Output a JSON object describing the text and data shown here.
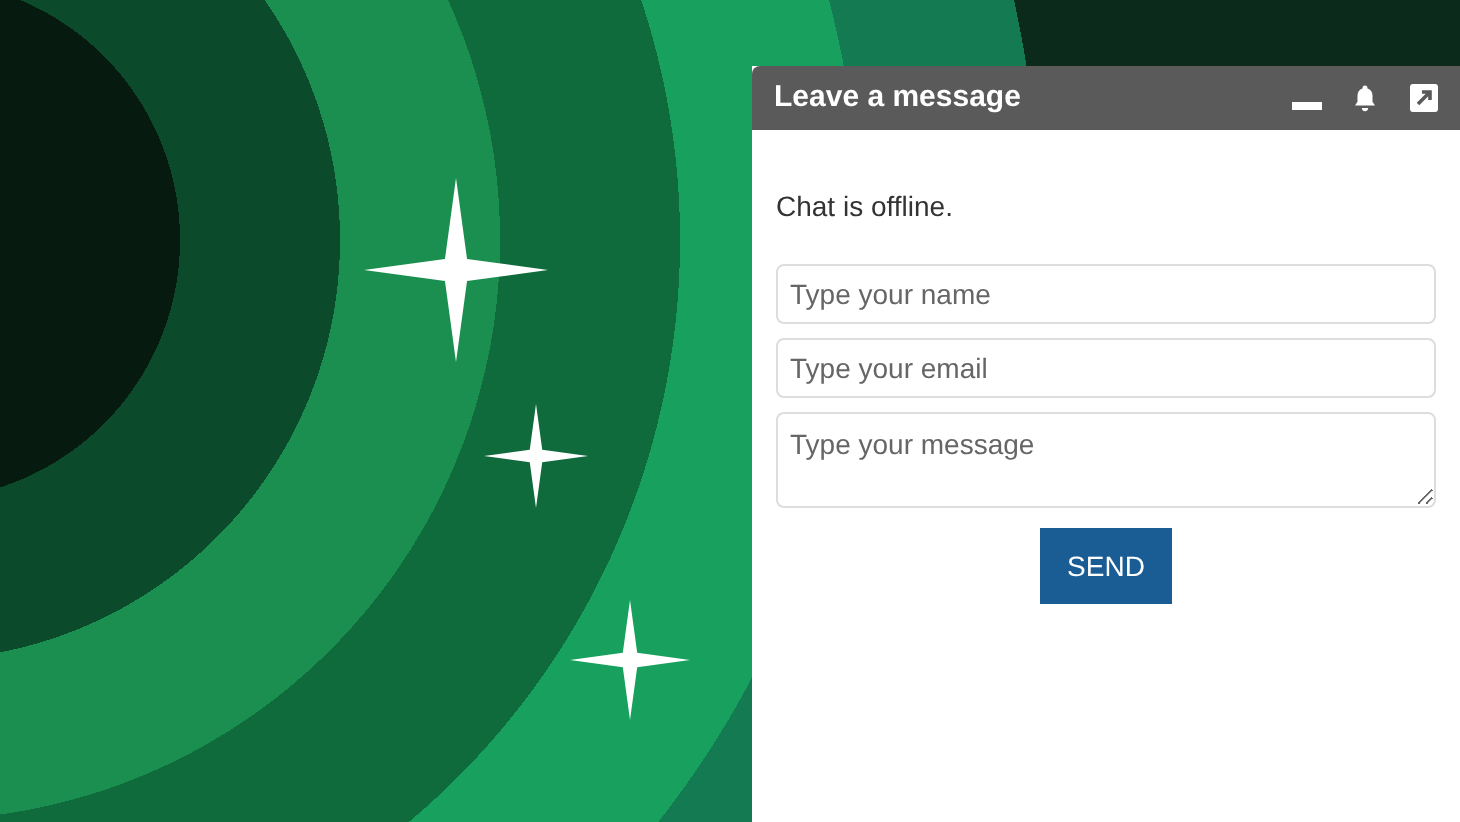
{
  "chat_widget": {
    "title": "Leave a message",
    "status": "Chat is offline.",
    "fields": [
      {
        "kind": "input",
        "placeholder": "Type your name"
      },
      {
        "kind": "input",
        "placeholder": "Type your email"
      },
      {
        "kind": "textarea",
        "placeholder": "Type your message"
      }
    ],
    "button": "SEND"
  }
}
